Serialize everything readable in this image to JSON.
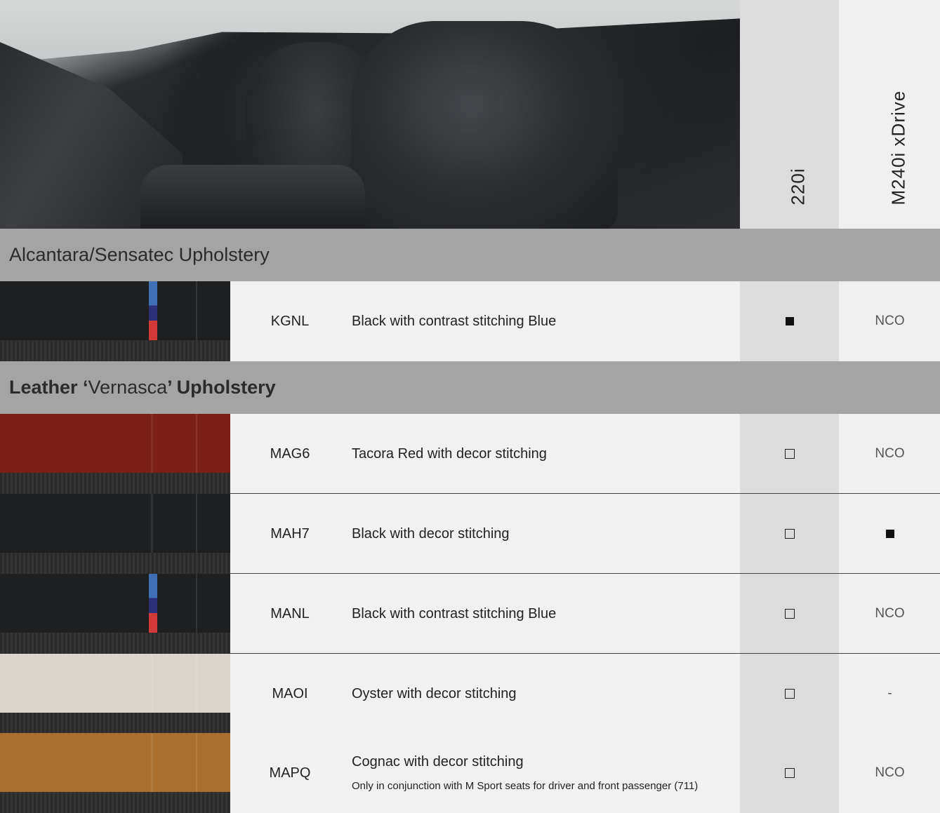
{
  "columns": {
    "model_a": "220i",
    "model_b": "M240i xDrive"
  },
  "sections": [
    {
      "title_parts": [
        "Alcantara/Sensatec Upholstery"
      ],
      "rows": [
        {
          "code": "KGNL",
          "description": "Black with contrast stitching Blue",
          "note": "",
          "model_a": "filled",
          "model_b": "NCO",
          "swatch_color": "#1d1f21",
          "m_stripe": true
        }
      ]
    },
    {
      "title_parts": [
        "Leather ‘",
        "Vernasca",
        "’ Upholstery"
      ],
      "rows": [
        {
          "code": "MAG6",
          "description": "Tacora Red with decor stitching",
          "note": "",
          "model_a": "empty",
          "model_b": "NCO",
          "swatch_color": "#7a1f17",
          "m_stripe": false
        },
        {
          "code": "MAH7",
          "description": "Black with decor stitching",
          "note": "",
          "model_a": "empty",
          "model_b": "filled",
          "swatch_color": "#1e1f21",
          "m_stripe": false
        },
        {
          "code": "MANL",
          "description": "Black with contrast stitching Blue",
          "note": "",
          "model_a": "empty",
          "model_b": "NCO",
          "swatch_color": "#1e1f21",
          "m_stripe": true
        },
        {
          "code": "MAOI",
          "description": "Oyster with decor stitching",
          "note": "",
          "model_a": "empty",
          "model_b": "-",
          "swatch_color": "#d9d5cc",
          "m_stripe": false
        },
        {
          "code": "MAPQ",
          "description": "Cognac with decor stitching",
          "note": "Only in conjunction with M Sport seats for driver and front passenger (711)",
          "model_a": "empty",
          "model_b": "NCO",
          "swatch_color": "#a9702f",
          "m_stripe": false
        }
      ]
    }
  ],
  "colors": {
    "section_bar": "#a4a4a4",
    "col_a_bg": "#dcdcdc",
    "col_b_bg": "#f0f0f0"
  }
}
